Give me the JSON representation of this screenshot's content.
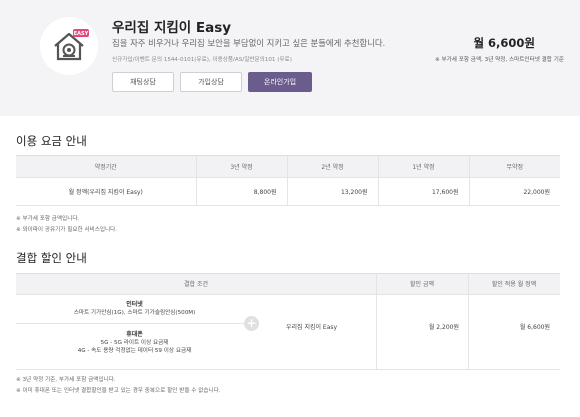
{
  "product": {
    "logo_badge": "EASY",
    "title": "우리집 지킴이 Easy",
    "description": "집을 자주 비우거나 우리집 보안을 부담없이 지키고 싶은 분들에게 추천합니다.",
    "contact": "신규가입/이벤트 문의 1544-0101(유료), 이용상품/AS/일반문의101 (무료)",
    "price": "월 6,600원",
    "price_note": "※ 부가세 포함 금액, 3년 약정, 스마트인터넷 결합 기준",
    "buttons": {
      "chat": "채팅상담",
      "join": "가입상담",
      "online": "온라인가입"
    },
    "accent_color": "#6a5c8c",
    "badge_color": "#e5467e"
  },
  "fee_section": {
    "title": "이용 요금 안내",
    "headers": [
      "약정기간",
      "3년 약정",
      "2년 약정",
      "1년 약정",
      "무약정"
    ],
    "row": {
      "name": "월 정액(우리집 지킴이 Easy)",
      "values": [
        "8,800원",
        "13,200원",
        "17,600원",
        "22,000원"
      ]
    },
    "notes": [
      "※ 부가세 포함 금액입니다.",
      "※ 와이파이 공유기가 필요한 서비스입니다."
    ]
  },
  "combo_section": {
    "title": "결합 할인 안내",
    "headers": [
      "결합 조건",
      "할인 금액",
      "할인 적용 월 정액"
    ],
    "internet": {
      "label": "인터넷",
      "detail": "스마트 기가안심(1G), 스마트 기가슬림안심(500M)"
    },
    "mobile": {
      "label": "휴대폰",
      "line1": "5G - 5G 라이트 이상 요금제",
      "line2": "4G - 속도 용량 걱정없는 데이터 59 이상 요금제"
    },
    "plus_icon": "plus-circle-icon",
    "service": "우리집 지킴이 Easy",
    "discount": "월 2,200원",
    "final_price": "월 6,600원",
    "notes": [
      "※ 3년 약정 기준, 부가세 포함 금액입니다.",
      "※ 이미 휴대폰 또는 인터넷 결합할인을 받고 있는 경우 중복으로 할인 받을 수 없습니다."
    ]
  }
}
